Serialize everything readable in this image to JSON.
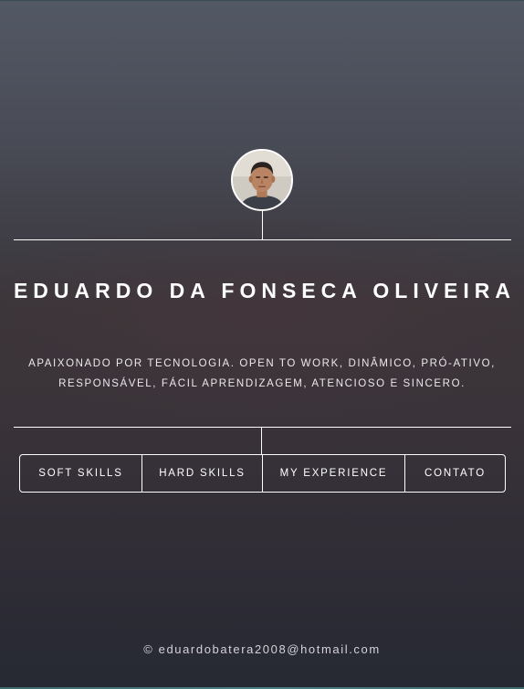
{
  "profile": {
    "name": "EDUARDO DA FONSECA OLIVEIRA",
    "tagline": "APAIXONADO POR TECNOLOGIA. OPEN TO WORK, DINÂMICO, PRÓ-ATIVO, RESPONSÁVEL, FÁCIL APRENDIZAGEM, ATENCIOSO E SINCERO."
  },
  "nav": {
    "items": [
      {
        "label": "SOFT SKILLS"
      },
      {
        "label": "HARD SKILLS"
      },
      {
        "label": "MY EXPERIENCE"
      },
      {
        "label": "CONTATO"
      }
    ]
  },
  "footer": {
    "text": "© eduardobatera2008@hotmail.com"
  },
  "colors": {
    "background_top": "#525864",
    "background_bottom": "#262933",
    "foreground": "#ffffff"
  },
  "icons": {
    "avatar": "profile-photo"
  }
}
